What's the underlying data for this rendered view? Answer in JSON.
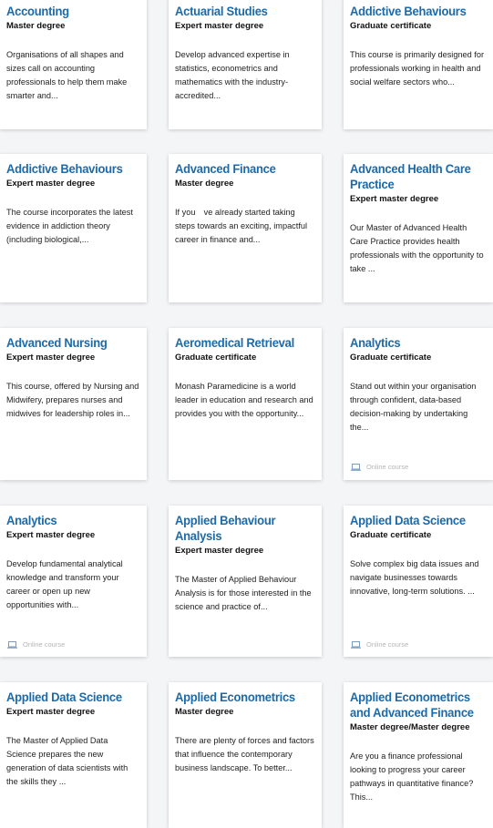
{
  "courses": [
    {
      "title": "Accounting",
      "type": "Master degree",
      "desc": "Organisations of all shapes and sizes call on accounting professionals to help them make smarter and..."
    },
    {
      "title": "Actuarial Studies",
      "type": "Expert master degree",
      "desc": "Develop advanced expertise in statistics, econometrics and mathematics with the industry-accredited..."
    },
    {
      "title": "Addictive Behaviours",
      "type": "Graduate certificate",
      "desc": "This course is primarily designed for professionals working in health and social welfare sectors who..."
    },
    {
      "title": "Addictive Behaviours",
      "type": "Expert master degree",
      "desc": "The course incorporates the latest evidence in addiction theory (including biological,..."
    },
    {
      "title": "Advanced Finance",
      "type": "Master degree",
      "desc": "If you　ve already started taking steps towards an exciting, impactful career in finance and..."
    },
    {
      "title": "Advanced Health Care Practice",
      "type": "Expert master degree",
      "desc": "Our Master of Advanced Health Care Practice provides health professionals with the opportunity to take ..."
    },
    {
      "title": "Advanced Nursing",
      "type": "Expert master degree",
      "desc": "This course, offered by Nursing and Midwifery, prepares nurses and midwives for leadership roles in..."
    },
    {
      "title": "Aeromedical Retrieval",
      "type": "Graduate certificate",
      "desc": "Monash Paramedicine is a world leader in education and research and provides you with the opportunity..."
    },
    {
      "title": "Analytics",
      "type": "Graduate certificate",
      "desc": "Stand out within your organisation through confident, data-based decision-making by undertaking the...",
      "online": "Online course"
    },
    {
      "title": "Analytics",
      "type": "Expert master degree",
      "desc": "Develop fundamental analytical knowledge and transform your career or open up new opportunities with...",
      "online": "Online course"
    },
    {
      "title": "Applied Behaviour Analysis",
      "type": "Expert master degree",
      "desc": "The Master of Applied Behaviour Analysis is for those interested in the science and practice of..."
    },
    {
      "title": "Applied Data Science",
      "type": "Graduate certificate",
      "desc": "Solve complex big data issues and navigate businesses towards innovative, long-term solutions. ...",
      "online": "Online course"
    },
    {
      "title": "Applied Data Science",
      "type": "Expert master degree",
      "desc": "The Master of Applied Data Science prepares the new generation of data scientists with the skills they ..."
    },
    {
      "title": "Applied Econometrics",
      "type": "Master degree",
      "desc": "There are plenty of forces and factors that influence the contemporary business landscape. To better..."
    },
    {
      "title": "Applied Econometrics and Advanced Finance",
      "type": "Master degree/Master degree",
      "desc": "Are you a finance professional looking to progress your career pathways in quantitative finance? This..."
    }
  ]
}
